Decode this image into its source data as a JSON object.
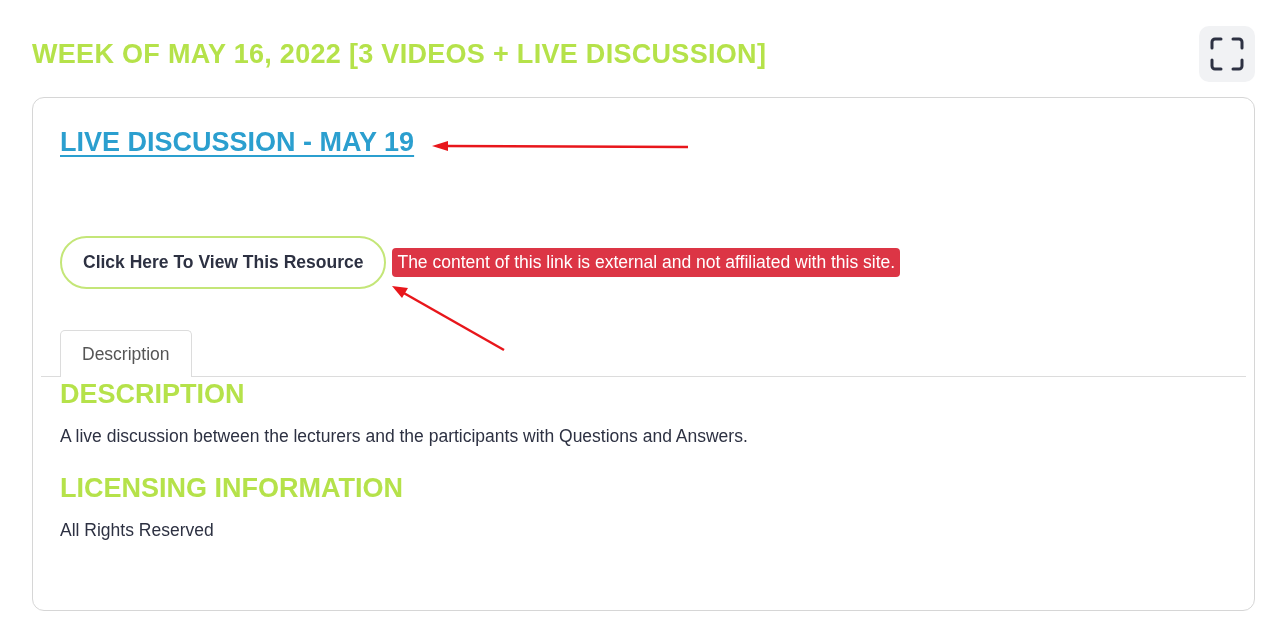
{
  "section_title": "WEEK OF MAY 16, 2022 [3 VIDEOS + LIVE DISCUSSION]",
  "card": {
    "title": "LIVE DISCUSSION - MAY 19",
    "resource_button": "Click Here To View This Resource",
    "external_notice": "The content of this link is external and not affiliated with this site.",
    "tabs": [
      {
        "label": "Description",
        "selected": true
      }
    ],
    "sections": [
      {
        "heading": "DESCRIPTION",
        "text": "A live discussion between the lecturers and the participants with Questions and Answers."
      },
      {
        "heading": "LICENSING INFORMATION",
        "text": "All Rights Reserved"
      }
    ]
  }
}
